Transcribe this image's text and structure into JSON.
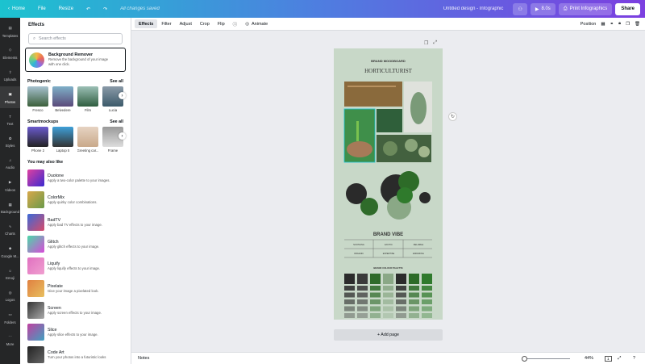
{
  "topbar": {
    "home": "Home",
    "file": "File",
    "resize": "Resize",
    "save_status": "All changes saved",
    "doc_title": "Untitled design - Infographic",
    "duration": "8.0s",
    "print_label": "Print Infographics",
    "share": "Share"
  },
  "rail": [
    {
      "label": "Templates",
      "icon": "templates-icon"
    },
    {
      "label": "Elements",
      "icon": "elements-icon"
    },
    {
      "label": "Uploads",
      "icon": "uploads-icon"
    },
    {
      "label": "Photos",
      "icon": "photos-icon"
    },
    {
      "label": "Text",
      "icon": "text-icon"
    },
    {
      "label": "Styles",
      "icon": "styles-icon"
    },
    {
      "label": "Audio",
      "icon": "audio-icon"
    },
    {
      "label": "Videos",
      "icon": "videos-icon"
    },
    {
      "label": "Background",
      "icon": "background-icon"
    },
    {
      "label": "Charts",
      "icon": "charts-icon"
    },
    {
      "label": "Google M...",
      "icon": "google-maps-icon"
    },
    {
      "label": "Emoji",
      "icon": "emoji-icon"
    },
    {
      "label": "Logos",
      "icon": "logos-icon"
    },
    {
      "label": "Folders",
      "icon": "folders-icon"
    },
    {
      "label": "More",
      "icon": "more-icon"
    }
  ],
  "panel": {
    "title": "Effects",
    "search_placeholder": "Search effects",
    "bg_remover": {
      "title": "Background Remover",
      "desc1": "Remove the background of your image",
      "desc2": "with one click."
    },
    "photogenic": {
      "title": "Photogenic",
      "see_all": "See all",
      "items": [
        "Fresco",
        "Belvedere",
        "Film",
        "Lucia"
      ]
    },
    "smartmockups": {
      "title": "Smartmockups",
      "see_all": "See all",
      "items": [
        "Phone 2",
        "Laptop 5",
        "Greeting car...",
        "Frame"
      ]
    },
    "also_like_title": "You may also like",
    "effects": [
      {
        "title": "Duotone",
        "desc": "Apply a two-color palette to your images."
      },
      {
        "title": "ColorMix",
        "desc": "Apply quirky color combinations."
      },
      {
        "title": "BadTV",
        "desc": "Apply bad TV effects to your image."
      },
      {
        "title": "Glitch",
        "desc": "Apply glitch effects to your image."
      },
      {
        "title": "Liquify",
        "desc": "Apply liquify effects to your image."
      },
      {
        "title": "Pixelate",
        "desc": "Give your image a pixelated look."
      },
      {
        "title": "Screen",
        "desc": "Apply screen effects to your image."
      },
      {
        "title": "Slice",
        "desc": "Apply slice effects to your image."
      },
      {
        "title": "Code Art",
        "desc": "Turn your photos into a futuristic looks"
      }
    ]
  },
  "toolbar": {
    "effects": "Effects",
    "filter": "Filter",
    "adjust": "Adjust",
    "crop": "Crop",
    "flip": "Flip",
    "animate": "Animate",
    "position": "Position"
  },
  "design": {
    "brand_moodboard": "BRAND MOODBOARD",
    "name": "HORTICULTURIST",
    "brand_vibe": "BRAND VIBE",
    "vibes": [
      "SOOTHING",
      "EXOTIC",
      "RELIABLE",
      "ORGANIC",
      "EXPERTISE",
      "ENDURING"
    ],
    "palette_title": "BRAND COLOUR PALETTE",
    "palette_colors": [
      "#2b2b2b",
      "#3a3a3a",
      "#2f6b2a",
      "#8aa886",
      "#2c2c2c",
      "#2d6b28",
      "#2f7a2c"
    ]
  },
  "canvas": {
    "add_page": "+ Add page"
  },
  "bottombar": {
    "notes": "Notes",
    "zoom": "44%",
    "page_count": "1"
  }
}
